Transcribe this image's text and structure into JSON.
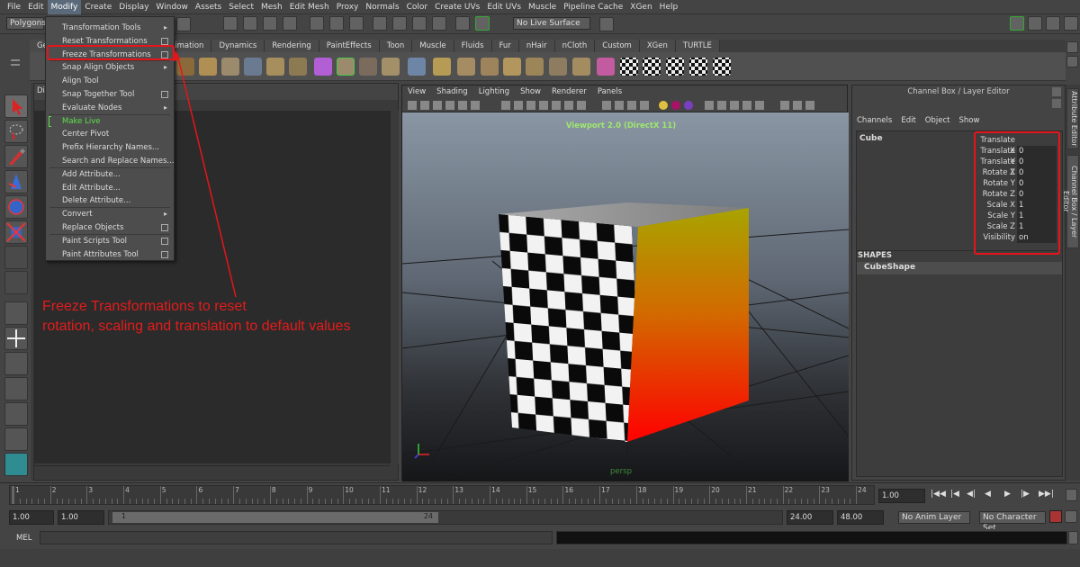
{
  "menubar": [
    "File",
    "Edit",
    "Modify",
    "Create",
    "Display",
    "Window",
    "Assets",
    "Select",
    "Mesh",
    "Edit Mesh",
    "Proxy",
    "Normals",
    "Color",
    "Create UVs",
    "Edit UVs",
    "Muscle",
    "Pipeline Cache",
    "XGen",
    "Help"
  ],
  "menubar_active": "Modify",
  "status": {
    "mode": "Polygons",
    "live_surface": "No Live Surface"
  },
  "shelf_tabs": [
    "Gen",
    "ons",
    "Deformation",
    "Animation",
    "Dynamics",
    "Rendering",
    "PaintEffects",
    "Toon",
    "Muscle",
    "Fluids",
    "Fur",
    "nHair",
    "nCloth",
    "Custom",
    "XGen",
    "TURTLE"
  ],
  "outliner": {
    "title": "Dis"
  },
  "modify_menu": [
    {
      "label": "Transformation Tools",
      "submenu": true
    },
    {
      "label": "Reset Transformations",
      "option": true
    },
    {
      "label": "Freeze Transformations",
      "option": true,
      "highlight": true
    },
    {
      "label": "Snap Align Objects",
      "submenu": true
    },
    {
      "label": "Align Tool"
    },
    {
      "label": "Snap Together Tool",
      "option": true
    },
    {
      "label": "Evaluate Nodes",
      "submenu": true
    },
    {
      "label": "Make Live",
      "live": true
    },
    {
      "label": "Center Pivot"
    },
    {
      "label": "Prefix Hierarchy Names..."
    },
    {
      "label": "Search and Replace Names..."
    },
    {
      "label": "Add Attribute..."
    },
    {
      "label": "Edit Attribute..."
    },
    {
      "label": "Delete Attribute..."
    },
    {
      "label": "Convert",
      "submenu": true
    },
    {
      "label": "Replace Objects",
      "option": true
    },
    {
      "label": "Paint Scripts Tool",
      "option": true
    },
    {
      "label": "Paint Attributes Tool",
      "option": true
    }
  ],
  "annotation": {
    "line1": "Freeze Transformations to reset",
    "line2": "rotation, scaling and translation to default values"
  },
  "viewport": {
    "menu": [
      "View",
      "Shading",
      "Lighting",
      "Show",
      "Renderer",
      "Panels"
    ],
    "renderer_label": "Viewport 2.0 (DirectX 11)",
    "camera_label": "persp"
  },
  "channel_box": {
    "title": "Channel Box / Layer Editor",
    "menu": [
      "Channels",
      "Edit",
      "Object",
      "Show"
    ],
    "object": "Cube",
    "channels": [
      {
        "name": "Translate X",
        "value": "0"
      },
      {
        "name": "Translate Y",
        "value": "0"
      },
      {
        "name": "Translate Z",
        "value": "0"
      },
      {
        "name": "Rotate X",
        "value": "0"
      },
      {
        "name": "Rotate Y",
        "value": "0"
      },
      {
        "name": "Rotate Z",
        "value": "0"
      },
      {
        "name": "Scale X",
        "value": "1"
      },
      {
        "name": "Scale Y",
        "value": "1"
      },
      {
        "name": "Scale Z",
        "value": "1"
      },
      {
        "name": "Visibility",
        "value": "on"
      }
    ],
    "shapes_header": "SHAPES",
    "shape": "CubeShape"
  },
  "side_tabs": [
    "Attribute Editor",
    "Channel Box / Layer Editor"
  ],
  "timeline": {
    "ticks": [
      "1",
      "2",
      "3",
      "4",
      "5",
      "6",
      "7",
      "8",
      "9",
      "10",
      "11",
      "12",
      "13",
      "14",
      "15",
      "16",
      "17",
      "18",
      "19",
      "20",
      "21",
      "22",
      "23",
      "24"
    ],
    "current_frame": "1.00"
  },
  "range": {
    "start": "1.00",
    "playback_start": "1.00",
    "range_start_label": "1",
    "range_end_label": "24",
    "playback_end": "24.00",
    "end": "48.00",
    "anim_layer": "No Anim Layer",
    "character_set": "No Character Set"
  },
  "cmdline": {
    "label": "MEL"
  },
  "colors": {
    "accent_red": "#e5151b",
    "live_green": "#5be04a",
    "viewport_label": "#9fe86e"
  }
}
